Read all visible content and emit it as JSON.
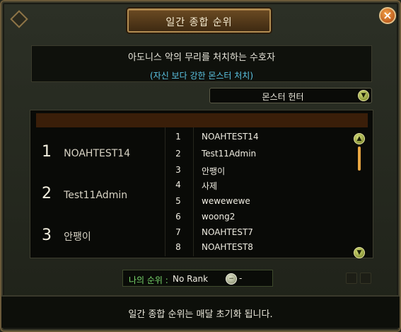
{
  "window": {
    "title": "일간 종합 순위",
    "close_symbol": "×"
  },
  "banner": {
    "title": "아도니스 악의 무리를 처치하는 수호자",
    "subtitle": "(자신 보다 강한 몬스터 처치)"
  },
  "category_select": {
    "value": "몬스터 헌터",
    "arrow_symbol": "▼"
  },
  "top_ranks": [
    {
      "rank": "1",
      "name": "NOAHTEST14"
    },
    {
      "rank": "2",
      "name": "Test11Admin"
    },
    {
      "rank": "3",
      "name": "안팽이"
    }
  ],
  "ranking_list": [
    {
      "rank": "1",
      "name": "NOAHTEST14"
    },
    {
      "rank": "2",
      "name": "Test11Admin"
    },
    {
      "rank": "3",
      "name": "안팽이"
    },
    {
      "rank": "4",
      "name": "사제"
    },
    {
      "rank": "5",
      "name": "wewewewe"
    },
    {
      "rank": "6",
      "name": "woong2"
    },
    {
      "rank": "7",
      "name": "NOAHTEST7"
    },
    {
      "rank": "8",
      "name": "NOAHTEST8"
    }
  ],
  "scrollbar": {
    "up_symbol": "▲",
    "down_symbol": "▼"
  },
  "my_rank": {
    "label": "나의 순위 :",
    "value": "No Rank",
    "button_symbol": "−",
    "extra": "-"
  },
  "footer": {
    "notice": "일간 종합 순위는 매달 초기화 됩니다."
  }
}
